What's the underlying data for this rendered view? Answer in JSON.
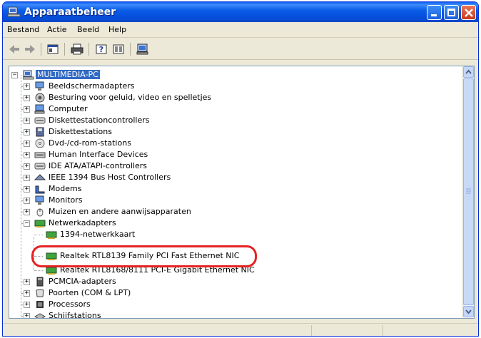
{
  "window": {
    "title": "Apparaatbeheer"
  },
  "menubar": {
    "items": [
      "Bestand",
      "Actie",
      "Beeld",
      "Help"
    ]
  },
  "toolbar": {
    "icons": [
      "back-icon",
      "forward-icon",
      "properties-icon",
      "print-icon",
      "help-icon",
      "view-icon",
      "scan-icon"
    ]
  },
  "tree": {
    "root": "MULTIMEDIA-PC",
    "items": [
      {
        "label": "Beeldschermadapters",
        "icon": "monitor-icon",
        "expanded": false
      },
      {
        "label": "Besturing voor geluid, video en spelletjes",
        "icon": "speaker-icon",
        "expanded": false
      },
      {
        "label": "Computer",
        "icon": "computer-icon",
        "expanded": false
      },
      {
        "label": "Diskettestationcontrollers",
        "icon": "disk-controller-icon",
        "expanded": false
      },
      {
        "label": "Diskettestations",
        "icon": "floppy-icon",
        "expanded": false
      },
      {
        "label": "Dvd-/cd-rom-stations",
        "icon": "cdrom-icon",
        "expanded": false
      },
      {
        "label": "Human Interface Devices",
        "icon": "hid-icon",
        "expanded": false
      },
      {
        "label": "IDE ATA/ATAPI-controllers",
        "icon": "ide-icon",
        "expanded": false
      },
      {
        "label": "IEEE 1394 Bus Host Controllers",
        "icon": "firewire-icon",
        "expanded": false
      },
      {
        "label": "Modems",
        "icon": "modem-icon",
        "expanded": false
      },
      {
        "label": "Monitors",
        "icon": "monitor-icon",
        "expanded": false
      },
      {
        "label": "Muizen en andere aanwijsapparaten",
        "icon": "mouse-icon",
        "expanded": false
      },
      {
        "label": "Netwerkadapters",
        "icon": "network-card-icon",
        "expanded": true
      }
    ],
    "network_children": [
      "1394-netwerkkaart",
      "Realtek RTL8139 Family PCI Fast Ethernet NIC",
      "Realtek RTL8168/8111 PCI-E Gigabit Ethernet NIC"
    ],
    "items_after": [
      {
        "label": "PCMCIA-adapters",
        "icon": "pcmcia-icon"
      },
      {
        "label": "Poorten (COM & LPT)",
        "icon": "port-icon"
      },
      {
        "label": "Processors",
        "icon": "processor-icon"
      },
      {
        "label": "Schijfstations",
        "icon": "disk-drive-icon"
      }
    ]
  },
  "colors": {
    "title_bar": "#0a5cf5",
    "selection": "#316ac5",
    "highlight_ring": "#e52222"
  }
}
